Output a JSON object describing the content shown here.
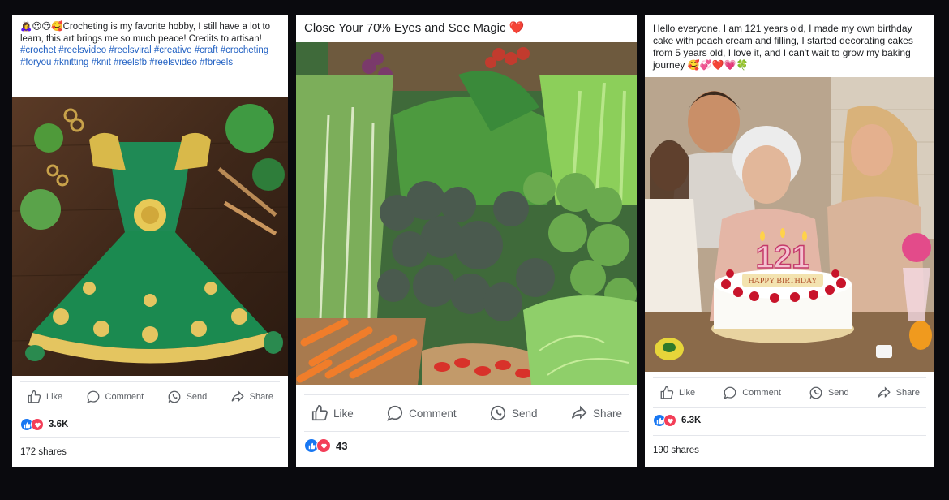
{
  "posts": [
    {
      "caption": "🙇‍♀️😍😍🥰Crocheting is my favorite hobby, I still have a lot to learn, this art brings me so much peace! Credits to artisan!",
      "hashtags": "#crochet #reelsvideo #reelsviral #creative #craft #crocheting #foryou #knitting #knit #reelsfb #reelsvideo #fbreels",
      "photo_icon": "crocheted-green-dress-photo",
      "actions": {
        "like": "Like",
        "comment": "Comment",
        "send": "Send",
        "share": "Share"
      },
      "reaction_count": "3.6K",
      "shares": "172 shares"
    },
    {
      "caption": "Close Your 70% Eyes and See Magic ❤️",
      "photo_icon": "vegetable-market-photo",
      "actions": {
        "like": "Like",
        "comment": "Comment",
        "send": "Send",
        "share": "Share"
      },
      "reaction_count": "43"
    },
    {
      "caption": "Hello everyone, I am 121 years old, I made my own birthday cake with peach cream and filling, I started decorating cakes from 5 years old, I love it, and I can't wait to grow my baking journey 🥰💞❤️💗🍀",
      "photo_icon": "elderly-woman-birthday-cake-photo",
      "cake_number": "121",
      "cake_text": "HAPPY BIRTHDAY",
      "actions": {
        "like": "Like",
        "comment": "Comment",
        "send": "Send",
        "share": "Share"
      },
      "reaction_count": "6.3K",
      "shares": "190 shares"
    }
  ],
  "colors": {
    "background": "#0a0a0e",
    "card": "#ffffff",
    "hashtag": "#1f5fc2",
    "like": "#1877f2",
    "love": "#f33e58",
    "muted": "#5c6066"
  }
}
